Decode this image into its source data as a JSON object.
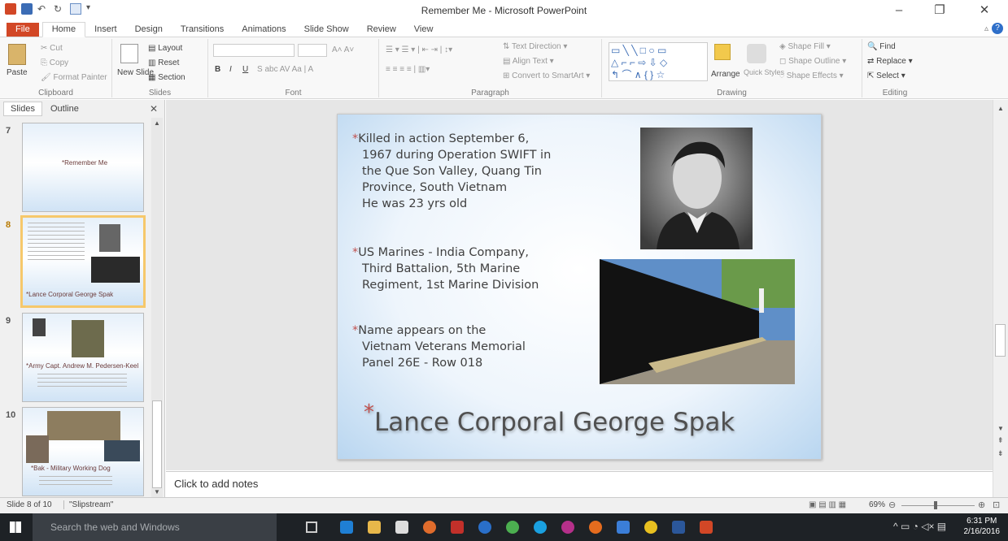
{
  "window": {
    "title": "Remember Me - Microsoft PowerPoint"
  },
  "tabs": [
    "File",
    "Home",
    "Insert",
    "Design",
    "Transitions",
    "Animations",
    "Slide Show",
    "Review",
    "View"
  ],
  "ribbon": {
    "clipboard": {
      "label": "Clipboard",
      "paste": "Paste",
      "cut": "Cut",
      "copy": "Copy",
      "format_painter": "Format Painter"
    },
    "slides": {
      "label": "Slides",
      "new_slide": "New Slide",
      "layout": "Layout",
      "reset": "Reset",
      "section": "Section"
    },
    "font": {
      "label": "Font"
    },
    "paragraph": {
      "label": "Paragraph",
      "text_direction": "Text Direction",
      "align_text": "Align Text",
      "convert": "Convert to SmartArt"
    },
    "drawing": {
      "label": "Drawing",
      "arrange": "Arrange",
      "quick_styles": "Quick Styles",
      "shape_fill": "Shape Fill",
      "shape_outline": "Shape Outline",
      "shape_effects": "Shape Effects"
    },
    "editing": {
      "label": "Editing",
      "find": "Find",
      "replace": "Replace",
      "select": "Select"
    }
  },
  "pane": {
    "tabs": [
      "Slides",
      "Outline"
    ]
  },
  "thumbnails": [
    {
      "num": "7",
      "title": "*Remember Me"
    },
    {
      "num": "8",
      "title": "*Lance Corporal  George Spak"
    },
    {
      "num": "9",
      "title": "*Army Capt. Andrew M. Pedersen-Keel"
    },
    {
      "num": "10",
      "title": "*Bak - Military Working Dog"
    }
  ],
  "slide": {
    "bullets": [
      {
        "lines": [
          "Killed in action September 6,",
          "1967 during Operation SWIFT in",
          "the Que Son Valley, Quang Tin",
          "Province, South Vietnam",
          "He was 23 yrs old"
        ]
      },
      {
        "lines": [
          "US Marines - India Company,",
          "Third Battalion, 5th Marine",
          "Regiment, 1st Marine Division"
        ]
      },
      {
        "lines": [
          "Name appears on the",
          "Vietnam Veterans Memorial",
          "Panel 26E - Row 018"
        ]
      }
    ],
    "title_star": "*",
    "title": "Lance Corporal  George Spak"
  },
  "notes": {
    "placeholder": "Click to add notes"
  },
  "status": {
    "slide": "Slide 8 of 10",
    "theme": "\"Slipstream\"",
    "zoom": "69%"
  },
  "taskbar": {
    "search": "Search the web and Windows",
    "time": "6:31 PM",
    "date": "2/16/2016"
  },
  "colors": {
    "file_tab": "#d24726",
    "accent_star": "#c0504d",
    "taskbar": "#1e2226"
  }
}
